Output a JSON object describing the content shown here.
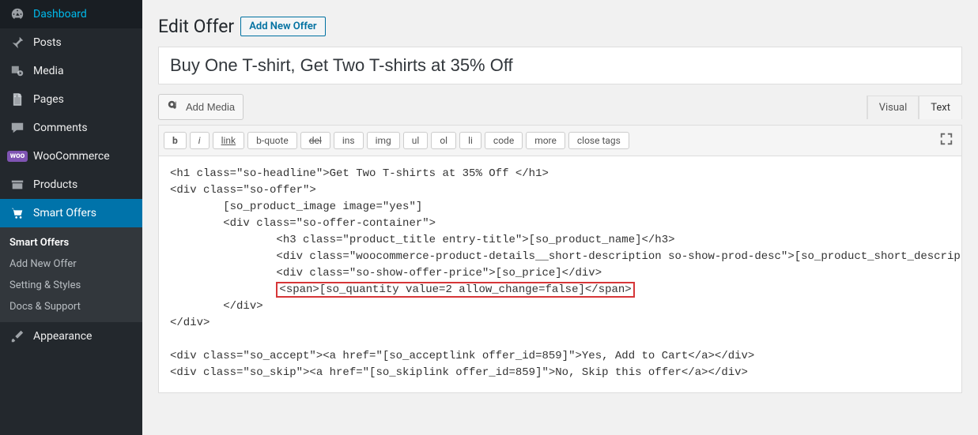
{
  "sidebar": {
    "items": [
      {
        "label": "Dashboard",
        "icon": "dashboard"
      },
      {
        "label": "Posts",
        "icon": "posts"
      },
      {
        "label": "Media",
        "icon": "media"
      },
      {
        "label": "Pages",
        "icon": "pages"
      },
      {
        "label": "Comments",
        "icon": "comments"
      },
      {
        "label": "WooCommerce",
        "icon": "woo"
      },
      {
        "label": "Products",
        "icon": "products"
      },
      {
        "label": "Smart Offers",
        "icon": "smart-offers"
      },
      {
        "label": "Appearance",
        "icon": "appearance"
      }
    ],
    "submenu": [
      {
        "label": "Smart Offers"
      },
      {
        "label": "Add New Offer"
      },
      {
        "label": "Setting & Styles"
      },
      {
        "label": "Docs & Support"
      }
    ]
  },
  "header": {
    "page_title": "Edit Offer",
    "page_action": "Add New Offer"
  },
  "title_input": {
    "value": "Buy One T-shirt, Get Two T-shirts at 35% Off"
  },
  "media_button": {
    "label": "Add Media"
  },
  "editor_tabs": {
    "visual": "Visual",
    "text": "Text"
  },
  "quicktags": {
    "b": "b",
    "i": "i",
    "link": "link",
    "bquote": "b-quote",
    "del": "del",
    "ins": "ins",
    "img": "img",
    "ul": "ul",
    "ol": "ol",
    "li": "li",
    "code": "code",
    "more": "more",
    "close": "close tags"
  },
  "editor_content": {
    "line1": "<h1 class=\"so-headline\">Get Two T-shirts at 35% Off </h1>",
    "line2": "<div class=\"so-offer\">",
    "line3": "        [so_product_image image=\"yes\"]",
    "line4": "        <div class=\"so-offer-container\">",
    "line5": "                <h3 class=\"product_title entry-title\">[so_product_name]</h3>",
    "line6": "                <div class=\"woocommerce-product-details__short-description so-show-prod-desc\">[so_product_short_description]</div>",
    "line7": "                <div class=\"so-show-offer-price\">[so_price]</div>",
    "line8_pre": "                ",
    "line8_hl": "<span>[so_quantity value=2 allow_change=false]</span>",
    "line9": "        </div>",
    "line10": "</div>",
    "line11": "",
    "line12": "<div class=\"so_accept\"><a href=\"[so_acceptlink offer_id=859]\">Yes, Add to Cart</a></div>",
    "line13": "<div class=\"so_skip\"><a href=\"[so_skiplink offer_id=859]\">No, Skip this offer</a></div>"
  }
}
